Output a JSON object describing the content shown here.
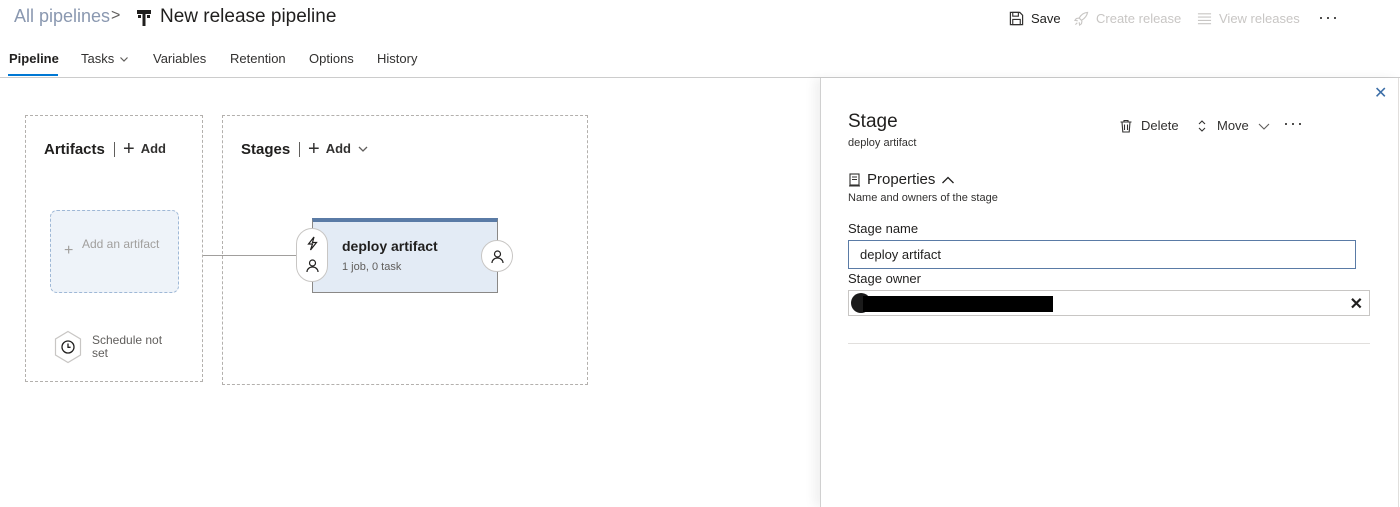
{
  "header": {
    "breadcrumb_root": "All pipelines",
    "breadcrumb_separator": ">",
    "title": "New release pipeline",
    "commands": {
      "save": "Save",
      "create_release": "Create release",
      "view_releases": "View releases",
      "more": "···"
    }
  },
  "tabs": [
    {
      "label": "Pipeline",
      "active": true
    },
    {
      "label": "Tasks",
      "active": false,
      "has_dropdown": true
    },
    {
      "label": "Variables",
      "active": false
    },
    {
      "label": "Retention",
      "active": false
    },
    {
      "label": "Options",
      "active": false
    },
    {
      "label": "History",
      "active": false
    }
  ],
  "artifacts": {
    "title": "Artifacts",
    "add_label": "Add",
    "placeholder_label": "Add an artifact",
    "schedule_label": "Schedule not set"
  },
  "stages": {
    "title": "Stages",
    "add_label": "Add",
    "cards": [
      {
        "name": "deploy artifact",
        "summary": "1 job, 0 task"
      }
    ]
  },
  "panel": {
    "title": "Stage",
    "subtitle": "deploy artifact",
    "commands": {
      "delete": "Delete",
      "move": "Move",
      "more": "···"
    },
    "section_title": "Properties",
    "section_description": "Name and owners of the stage",
    "stage_name_label": "Stage name",
    "stage_name_value": "deploy artifact",
    "stage_owner_label": "Stage owner",
    "close_glyph": "✕",
    "clear_glyph": "✕"
  },
  "colors": {
    "accent": "#0078d4",
    "stage_card_bg": "#e3ebf5",
    "stage_card_top": "#5a7ba6",
    "breadcrumb_link": "#8a98b0"
  }
}
